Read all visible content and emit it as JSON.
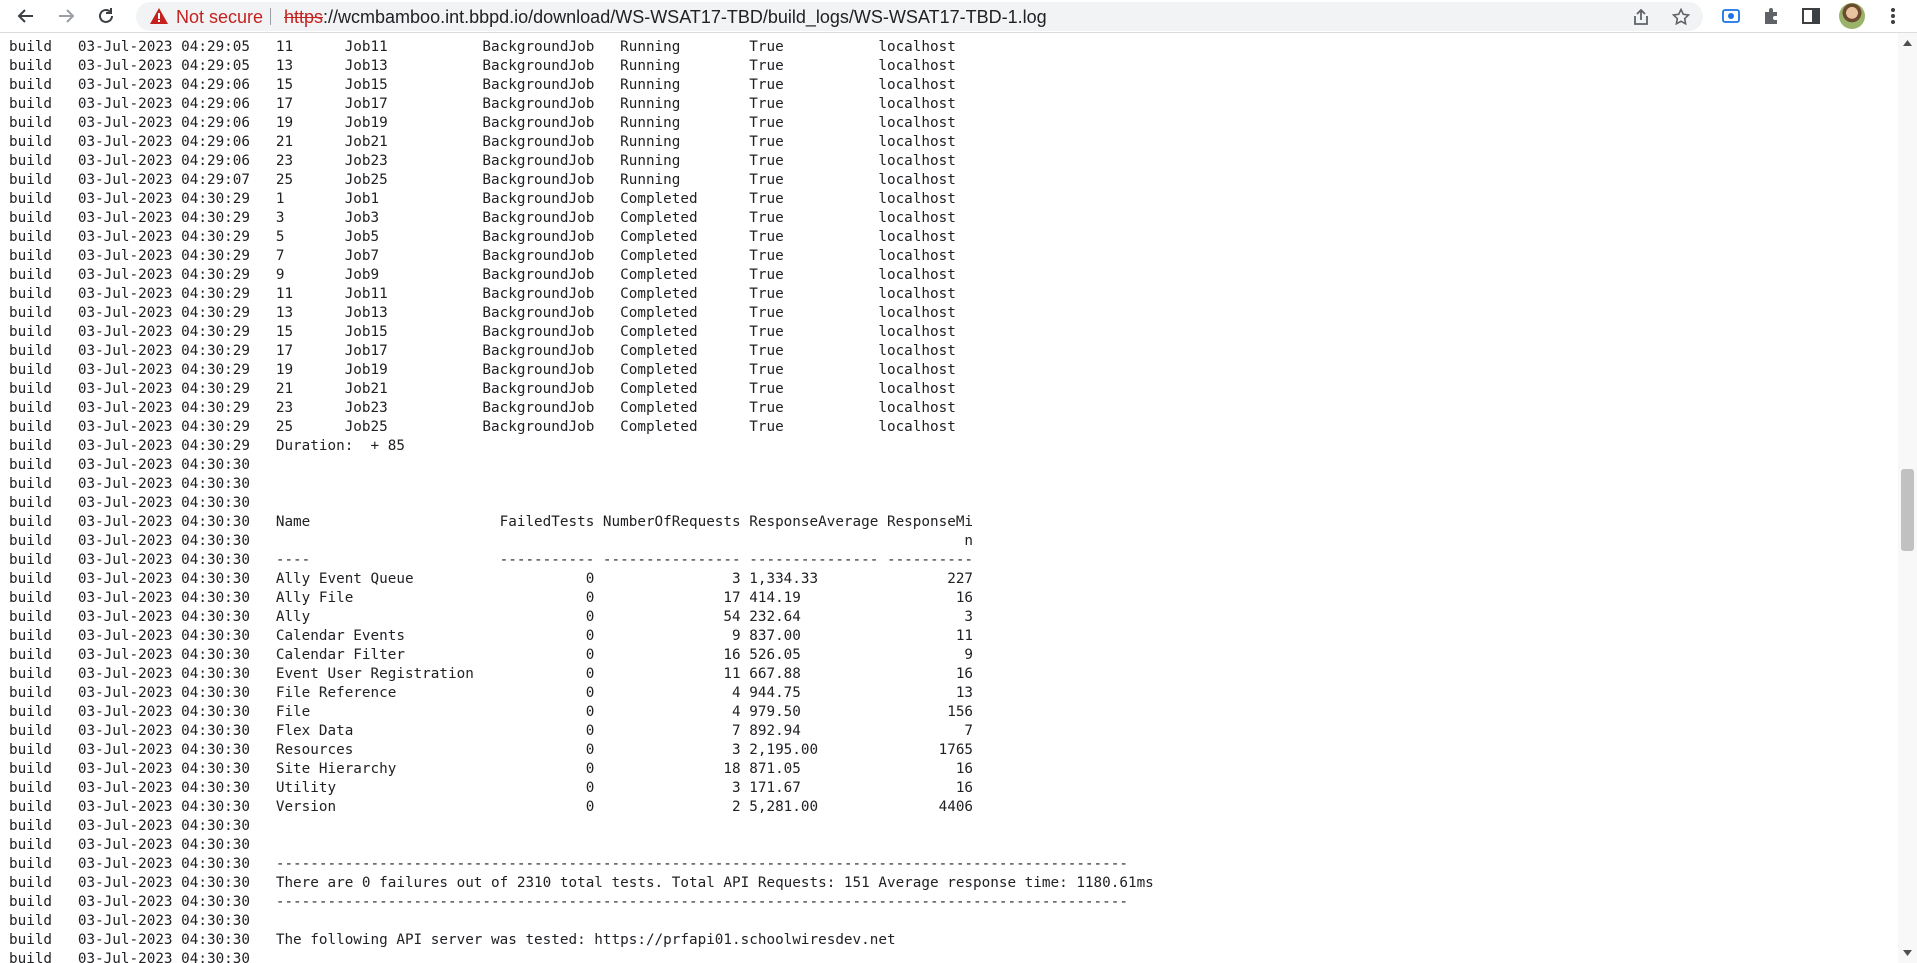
{
  "browser": {
    "security_label": "Not secure",
    "url_scheme": "https",
    "url_rest": "://wcmbamboo.int.bbpd.io/download/WS-WSAT17-TBD/build_logs/WS-WSAT17-TBD-1.log",
    "icons": [
      "back-icon",
      "forward-icon",
      "reload-icon",
      "warning-icon",
      "share-icon",
      "star-icon",
      "screencast-icon",
      "extensions-icon",
      "side-panel-icon",
      "avatar",
      "menu-icon"
    ],
    "colors": {
      "warning": "#c5221f",
      "omnibox": "#f1f3f4",
      "text": "#202124"
    }
  },
  "log": {
    "lines": [
      "build   03-Jul-2023 04:29:05   11      Job11           BackgroundJob   Running        True           localhost",
      "build   03-Jul-2023 04:29:05   13      Job13           BackgroundJob   Running        True           localhost",
      "build   03-Jul-2023 04:29:06   15      Job15           BackgroundJob   Running        True           localhost",
      "build   03-Jul-2023 04:29:06   17      Job17           BackgroundJob   Running        True           localhost",
      "build   03-Jul-2023 04:29:06   19      Job19           BackgroundJob   Running        True           localhost",
      "build   03-Jul-2023 04:29:06   21      Job21           BackgroundJob   Running        True           localhost",
      "build   03-Jul-2023 04:29:06   23      Job23           BackgroundJob   Running        True           localhost",
      "build   03-Jul-2023 04:29:07   25      Job25           BackgroundJob   Running        True           localhost",
      "build   03-Jul-2023 04:30:29   1       Job1            BackgroundJob   Completed      True           localhost",
      "build   03-Jul-2023 04:30:29   3       Job3            BackgroundJob   Completed      True           localhost",
      "build   03-Jul-2023 04:30:29   5       Job5            BackgroundJob   Completed      True           localhost",
      "build   03-Jul-2023 04:30:29   7       Job7            BackgroundJob   Completed      True           localhost",
      "build   03-Jul-2023 04:30:29   9       Job9            BackgroundJob   Completed      True           localhost",
      "build   03-Jul-2023 04:30:29   11      Job11           BackgroundJob   Completed      True           localhost",
      "build   03-Jul-2023 04:30:29   13      Job13           BackgroundJob   Completed      True           localhost",
      "build   03-Jul-2023 04:30:29   15      Job15           BackgroundJob   Completed      True           localhost",
      "build   03-Jul-2023 04:30:29   17      Job17           BackgroundJob   Completed      True           localhost",
      "build   03-Jul-2023 04:30:29   19      Job19           BackgroundJob   Completed      True           localhost",
      "build   03-Jul-2023 04:30:29   21      Job21           BackgroundJob   Completed      True           localhost",
      "build   03-Jul-2023 04:30:29   23      Job23           BackgroundJob   Completed      True           localhost",
      "build   03-Jul-2023 04:30:29   25      Job25           BackgroundJob   Completed      True           localhost",
      "build   03-Jul-2023 04:30:29   Duration:  + 85",
      "build   03-Jul-2023 04:30:30",
      "build   03-Jul-2023 04:30:30",
      "build   03-Jul-2023 04:30:30",
      "build   03-Jul-2023 04:30:30   Name                      FailedTests NumberOfRequests ResponseAverage ResponseMi",
      "build   03-Jul-2023 04:30:30                                                                                   n",
      "build   03-Jul-2023 04:30:30   ----                      ----------- ---------------- --------------- ----------",
      "build   03-Jul-2023 04:30:30   Ally Event Queue                    0                3 1,334.33               227",
      "build   03-Jul-2023 04:30:30   Ally File                           0               17 414.19                  16",
      "build   03-Jul-2023 04:30:30   Ally                                0               54 232.64                   3",
      "build   03-Jul-2023 04:30:30   Calendar Events                     0                9 837.00                  11",
      "build   03-Jul-2023 04:30:30   Calendar Filter                     0               16 526.05                   9",
      "build   03-Jul-2023 04:30:30   Event User Registration             0               11 667.88                  16",
      "build   03-Jul-2023 04:30:30   File Reference                      0                4 944.75                  13",
      "build   03-Jul-2023 04:30:30   File                                0                4 979.50                 156",
      "build   03-Jul-2023 04:30:30   Flex Data                           0                7 892.94                   7",
      "build   03-Jul-2023 04:30:30   Resources                           0                3 2,195.00              1765",
      "build   03-Jul-2023 04:30:30   Site Hierarchy                      0               18 871.05                  16",
      "build   03-Jul-2023 04:30:30   Utility                             0                3 171.67                  16",
      "build   03-Jul-2023 04:30:30   Version                             0                2 5,281.00              4406",
      "build   03-Jul-2023 04:30:30",
      "build   03-Jul-2023 04:30:30",
      "build   03-Jul-2023 04:30:30   ---------------------------------------------------------------------------------------------------",
      "build   03-Jul-2023 04:30:30   There are 0 failures out of 2310 total tests. Total API Requests: 151 Average response time: 1180.61ms",
      "build   03-Jul-2023 04:30:30   ---------------------------------------------------------------------------------------------------",
      "build   03-Jul-2023 04:30:30",
      "build   03-Jul-2023 04:30:30   The following API server was tested: https://prfapi01.schoolwiresdev.net",
      "build   03-Jul-2023 04:30:30"
    ]
  }
}
